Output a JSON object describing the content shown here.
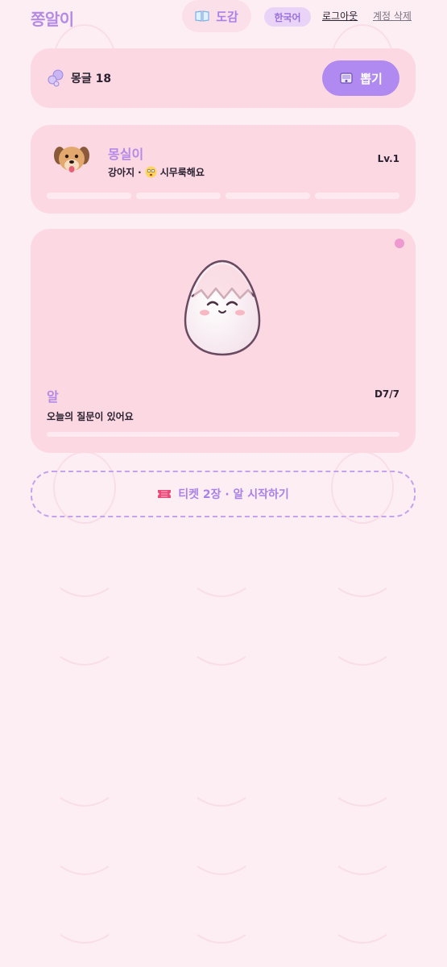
{
  "header": {
    "app_title": "쫑알이",
    "dex_label": "도감",
    "language_label": "한국어",
    "logout_label": "로그아웃",
    "delete_account_label": "계정 삭제"
  },
  "currency": {
    "label": "몽글 18",
    "icon": "bubble-icon",
    "draw_button_label": "뽑기",
    "draw_button_icon": "gacha-machine-icon"
  },
  "pet": {
    "name": "몽실이",
    "species": "강아지",
    "separator": "·",
    "mood": "시무룩해요",
    "mood_icon": "sad-face-icon",
    "level": "Lv.1",
    "stat_bars": [
      0,
      0,
      0,
      0
    ]
  },
  "egg": {
    "name": "알",
    "day": "D7/7",
    "message": "오늘의 질문이 있어요",
    "progress": 0
  },
  "ticket_button": {
    "label": "티켓 2장 · 알 시작하기",
    "icon": "ticket-icon"
  },
  "colors": {
    "background": "#fdeef3",
    "card": "#fcd8e3",
    "accent": "#b08af0",
    "title": "#b48ae6",
    "notification_dot": "#ee9ad0"
  }
}
